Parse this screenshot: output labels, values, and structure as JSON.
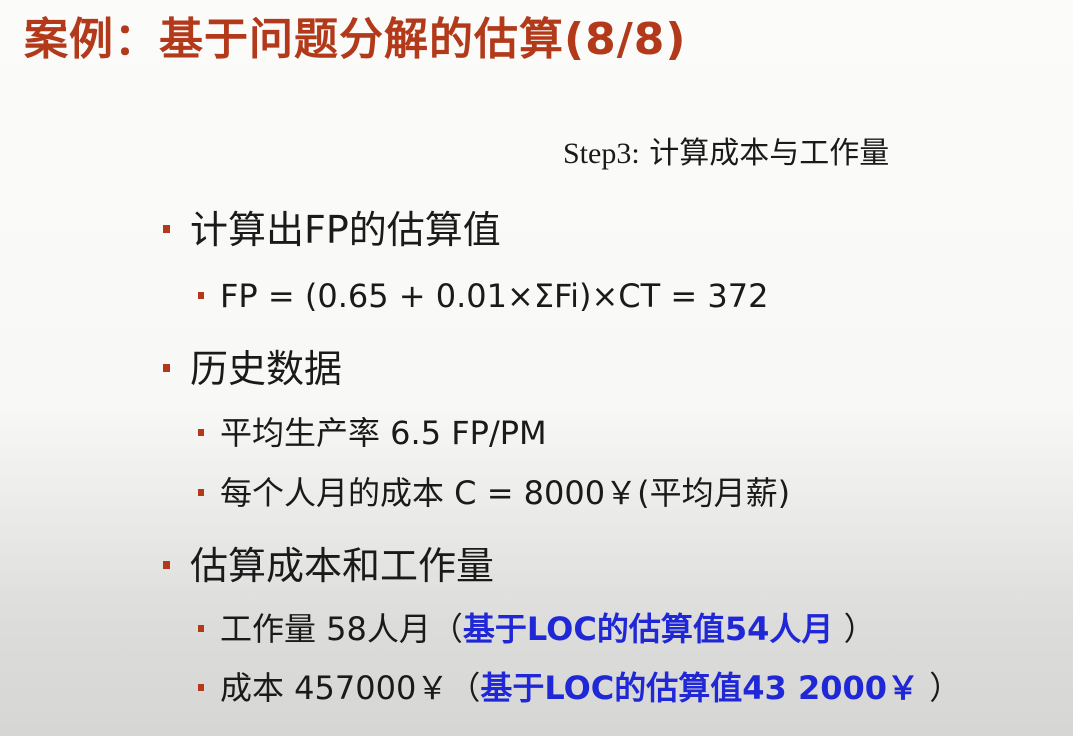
{
  "slide": {
    "title": "案例：基于问题分解的估算(8/8)",
    "step_en": "Step3:",
    "step_cn": "计算成本与工作量",
    "sections": [
      {
        "heading": "计算出FP的估算值",
        "items": [
          {
            "text": "FP = (0.65 + 0.01×ΣFi)×CT = 372"
          }
        ]
      },
      {
        "heading": "历史数据",
        "items": [
          {
            "text": "平均生产率 6.5 FP/PM"
          },
          {
            "text": "每个人月的成本 C = 8000￥(平均月薪)"
          }
        ]
      },
      {
        "heading": "估算成本和工作量",
        "items": [
          {
            "text": "工作量 58人月（",
            "highlight": "基于LOC的估算值54人月",
            "tail": "  ）"
          },
          {
            "text": "成本 457000￥（",
            "highlight": "基于LOC的估算值43 2000￥",
            "tail": "  ）"
          }
        ]
      }
    ],
    "colors": {
      "title": "#b23a1b",
      "bullet": "#b23a1b",
      "highlight": "#1f27d6",
      "text": "#1a1a1a"
    }
  }
}
